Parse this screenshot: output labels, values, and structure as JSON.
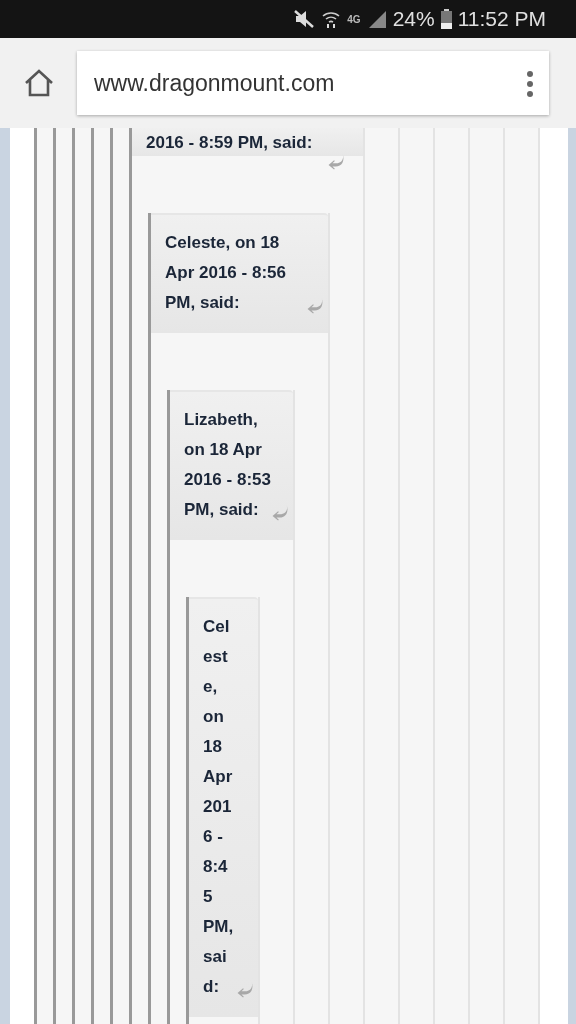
{
  "status_bar": {
    "network": "4G",
    "battery": "24%",
    "time": "11:52 PM"
  },
  "toolbar": {
    "url": "www.dragonmount.com"
  },
  "quotes": [
    {
      "citation": "2016 - 8:59 PM, said:",
      "children": [
        {
          "citation": "Celeste, on 18 Apr 2016 - 8:56 PM, said:",
          "children": [
            {
              "citation": "Lizabeth, on 18 Apr 2016 - 8:53 PM, said:",
              "children": [
                {
                  "citation": "Celeste, on 18 Apr 2016 - 8:45 PM, said:"
                }
              ]
            }
          ]
        }
      ]
    }
  ]
}
